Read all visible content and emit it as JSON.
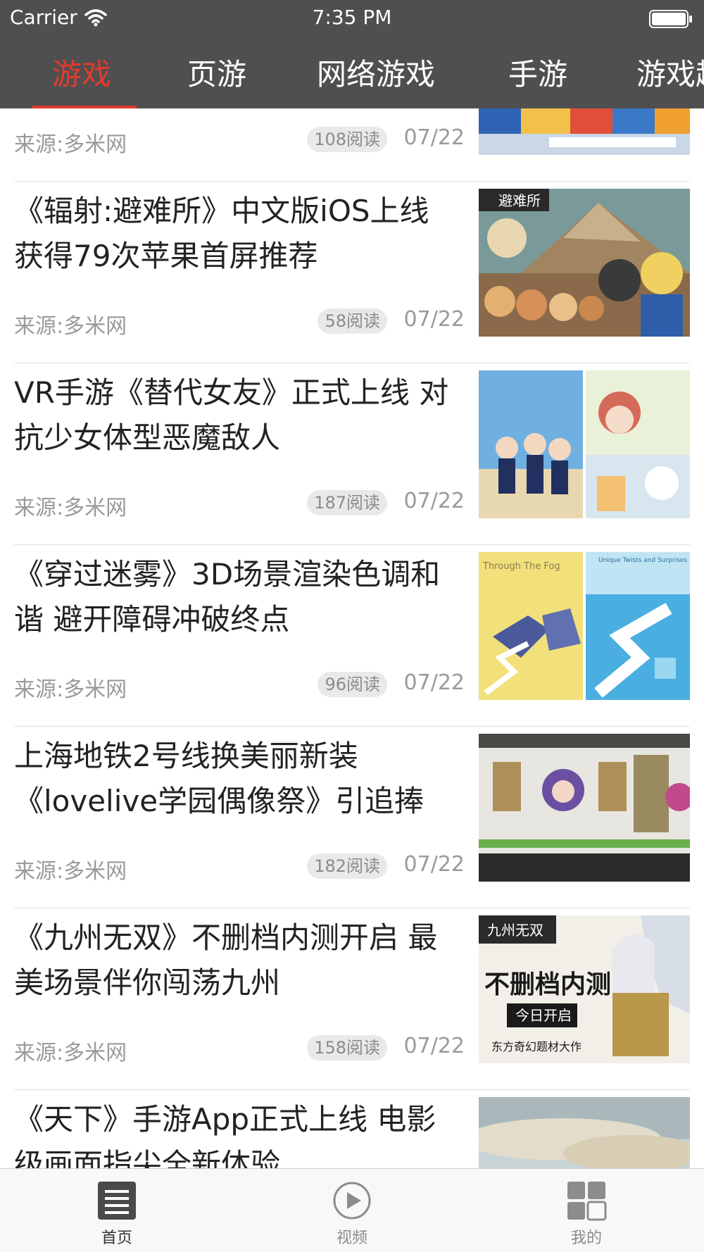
{
  "status_bar": {
    "carrier": "Carrier",
    "time": "7:35 PM",
    "icons": [
      "wifi-icon",
      "battery-icon"
    ]
  },
  "nav": {
    "tabs": [
      {
        "label": "游戏",
        "active": true
      },
      {
        "label": "页游",
        "active": false
      },
      {
        "label": "网络游戏",
        "active": false
      },
      {
        "label": "手游",
        "active": false
      },
      {
        "label": "游戏趣",
        "active": false
      }
    ],
    "accent_color": "#e23a2e",
    "background_color": "#4f4f4f"
  },
  "feed": {
    "items": [
      {
        "title": "",
        "source": "来源:多米网",
        "reads": "108阅读",
        "date": "07/22",
        "thumb": "city-street-game"
      },
      {
        "title": "《辐射:避难所》中文版iOS上线 获得79次苹果首屏推荐",
        "source": "来源:多米网",
        "reads": "58阅读",
        "date": "07/22",
        "thumb": "fallout-shelter-art"
      },
      {
        "title": "VR手游《替代女友》正式上线 对抗少女体型恶魔敌人",
        "source": "来源:多米网",
        "reads": "187阅读",
        "date": "07/22",
        "thumb": "anime-girls-collage"
      },
      {
        "title": "《穿过迷雾》3D场景渲染色调和谐 避开障碍冲破终点",
        "source": "来源:多米网",
        "reads": "96阅读",
        "date": "07/22",
        "thumb": "through-the-fog-screens"
      },
      {
        "title": "上海地铁2号线换美丽新装《lovelive学园偶像祭》引追捧",
        "source": "来源:多米网",
        "reads": "182阅读",
        "date": "07/22",
        "thumb": "metro-train-anime-wrap"
      },
      {
        "title": "《九州无双》不删档内测开启 最美场景伴你闯荡九州",
        "source": "来源:多米网",
        "reads": "158阅读",
        "date": "07/22",
        "thumb": "jiuzhou-wushuang-poster"
      },
      {
        "title": "《天下》手游App正式上线 电影级画面指尖全新体验",
        "source": "",
        "reads": "",
        "date": "",
        "thumb": "tianxia-landscape"
      }
    ],
    "thumb_texts": {
      "fog_left": "Through The Fog",
      "fog_right": "Unique Twists and Surprises",
      "fallout": "避难所",
      "jiuzhou_top": "九州无双",
      "jiuzhou_mid": "不删档内测",
      "jiuzhou_badge": "今日开启",
      "jiuzhou_bottom": "东方奇幻题材大作"
    }
  },
  "tab_bar": {
    "items": [
      {
        "label": "首页",
        "icon": "news-list-icon",
        "active": true
      },
      {
        "label": "视频",
        "icon": "play-circle-icon",
        "active": false
      },
      {
        "label": "我的",
        "icon": "grid-icon",
        "active": false
      }
    ]
  }
}
